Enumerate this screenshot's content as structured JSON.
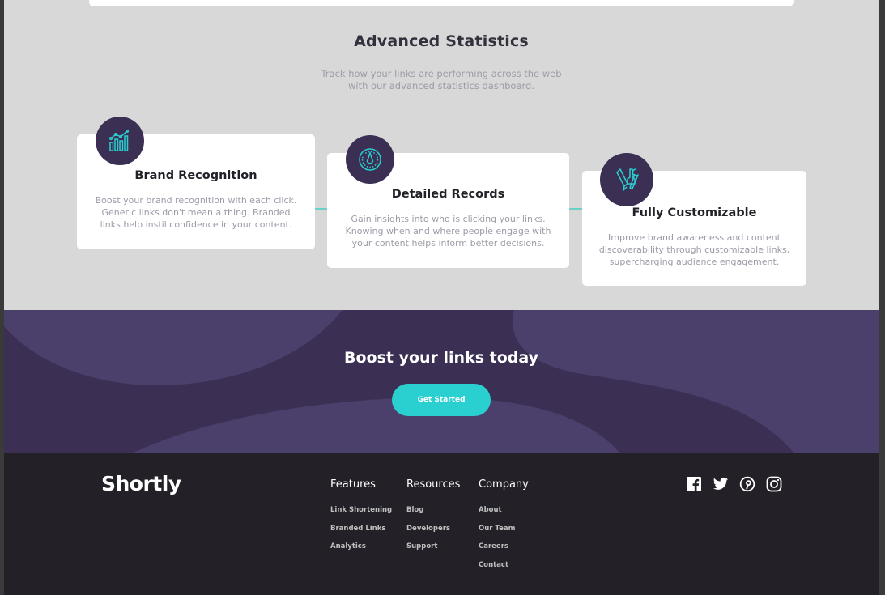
{
  "statistics": {
    "title": "Advanced Statistics",
    "subtitle_line1": "Track how your links are performing across the web",
    "subtitle_line2": "with our advanced statistics dashboard.",
    "cards": [
      {
        "icon": "chart-icon",
        "title": "Brand Recognition",
        "text": [
          "Boost your brand recognition with each click.",
          "Generic links don't mean a thing. Branded",
          "links help instil confidence in your content."
        ]
      },
      {
        "icon": "gauge-icon",
        "title": "Detailed Records",
        "text": [
          "Gain insights into who is clicking your links.",
          "Knowing when and where people engage with",
          "your content helps inform better decisions."
        ]
      },
      {
        "icon": "tools-icon",
        "title": "Fully Customizable",
        "text": [
          "Improve brand awareness and content",
          "discoverability through customizable links,",
          "supercharging audience engagement."
        ]
      }
    ]
  },
  "boost": {
    "title": "Boost your links today",
    "button_label": "Get Started"
  },
  "footer": {
    "logo": "Shortly",
    "columns": [
      {
        "heading": "Features",
        "links": [
          "Link Shortening",
          "Branded Links",
          "Analytics"
        ]
      },
      {
        "heading": "Resources",
        "links": [
          "Blog",
          "Developers",
          "Support"
        ]
      },
      {
        "heading": "Company",
        "links": [
          "About",
          "Our Team",
          "Careers",
          "Contact"
        ]
      }
    ],
    "social": [
      "facebook-icon",
      "twitter-icon",
      "pinterest-icon",
      "instagram-icon"
    ]
  },
  "colors": {
    "dark_violet": "#3b3054",
    "cyan": "#2acfcf",
    "light_gray_bg": "#d8d8d8",
    "very_dark_violet": "#232127",
    "grayish_violet": "#9e9aa7"
  }
}
